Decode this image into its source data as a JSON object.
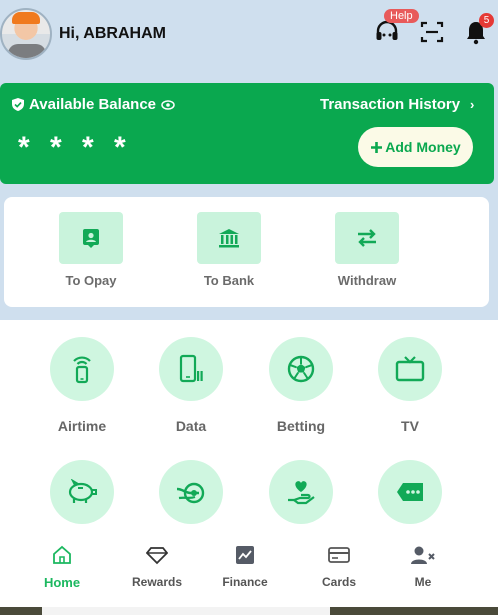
{
  "header": {
    "greeting": "Hi, ABRAHAM",
    "help_badge": "Help",
    "notification_count": "5",
    "icons": [
      "headset-icon",
      "scan-icon",
      "bell-icon"
    ]
  },
  "balance": {
    "label": "Available Balance",
    "transaction_history": "Transaction History",
    "masked_amount": "* * * *",
    "add_money": "Add Money",
    "card_color": "#0aa84f"
  },
  "transfers": [
    {
      "label": "To Opay",
      "icon": "wallet-icon"
    },
    {
      "label": "To Bank",
      "icon": "bank-icon"
    },
    {
      "label": "Withdraw",
      "icon": "swap-icon"
    }
  ],
  "services": [
    {
      "label": "Airtime",
      "icon": "phone-signal-icon"
    },
    {
      "label": "Data",
      "icon": "data-phone-icon"
    },
    {
      "label": "Betting",
      "icon": "soccer-ball-icon"
    },
    {
      "label": "TV",
      "icon": "tv-icon"
    },
    {
      "label": "",
      "icon": "piggy-bank-icon"
    },
    {
      "label": "",
      "icon": "loan-icon"
    },
    {
      "label": "",
      "icon": "heart-hand-icon"
    },
    {
      "label": "",
      "icon": "more-icon"
    }
  ],
  "nav": [
    {
      "label": "Home",
      "icon": "home-icon",
      "active": true
    },
    {
      "label": "Rewards",
      "icon": "diamond-icon"
    },
    {
      "label": "Finance",
      "icon": "chart-icon"
    },
    {
      "label": "Cards",
      "icon": "card-icon"
    },
    {
      "label": "Me",
      "icon": "user-icon"
    }
  ],
  "colors": {
    "accent": "#0aa84f",
    "soft_green": "#cff6e0",
    "badge_red": "#e53935"
  }
}
